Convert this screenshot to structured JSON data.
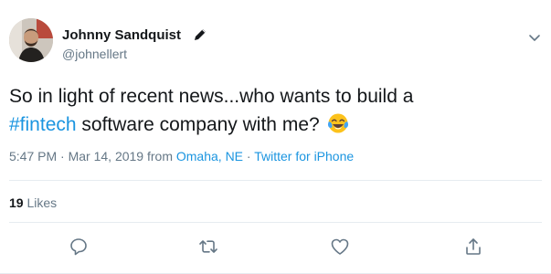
{
  "author": {
    "display_name": "Johnny Sandquist",
    "handle": "@johnellert",
    "verified_icon": "pen-icon"
  },
  "tweet": {
    "text_before": "So in light of recent news...who wants to build a",
    "hashtag": "#fintech",
    "text_after": " software company with me? ",
    "emoji": "tears-of-joy-emoji"
  },
  "meta": {
    "time": "5:47 PM",
    "separator1": " · ",
    "date": "Mar 14, 2019",
    "from_label": " from ",
    "location": "Omaha, NE",
    "separator2": " · ",
    "client": "Twitter for iPhone"
  },
  "stats": {
    "likes_count": "19",
    "likes_label": " Likes"
  },
  "actions": [
    {
      "name": "reply",
      "icon": "reply-icon"
    },
    {
      "name": "retweet",
      "icon": "retweet-icon"
    },
    {
      "name": "like",
      "icon": "heart-icon"
    },
    {
      "name": "share",
      "icon": "share-icon"
    }
  ],
  "colors": {
    "accent": "#1b95e0",
    "secondary_text": "#657786",
    "primary_text": "#14171a",
    "divider": "#e6ecf0"
  }
}
